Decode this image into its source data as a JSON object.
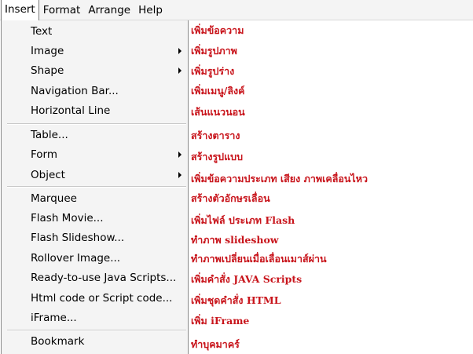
{
  "menubar": {
    "items": [
      {
        "label": "Insert",
        "active": true
      },
      {
        "label": "Format",
        "active": false
      },
      {
        "label": "Arrange",
        "active": false
      },
      {
        "label": "Help",
        "active": false
      }
    ]
  },
  "insert_menu": {
    "items": [
      {
        "label": "Text",
        "submenu": false
      },
      {
        "label": "Image",
        "submenu": true
      },
      {
        "label": "Shape",
        "submenu": true
      },
      {
        "label": "Navigation Bar...",
        "submenu": false
      },
      {
        "label": "Horizontal Line",
        "submenu": false
      },
      {
        "label": "Table...",
        "submenu": false
      },
      {
        "label": "Form",
        "submenu": true
      },
      {
        "label": "Object",
        "submenu": true
      },
      {
        "label": "Marquee",
        "submenu": false
      },
      {
        "label": "Flash Movie...",
        "submenu": false
      },
      {
        "label": "Flash Slideshow...",
        "submenu": false
      },
      {
        "label": "Rollover Image...",
        "submenu": false
      },
      {
        "label": "Ready-to-use Java Scripts...",
        "submenu": false
      },
      {
        "label": "Html code or Script code...",
        "submenu": false
      },
      {
        "label": "iFrame...",
        "submenu": false
      },
      {
        "label": "Bookmark",
        "submenu": false
      }
    ]
  },
  "annotations": [
    "เพิ่มข้อความ",
    "เพิ่มรูปภาพ",
    "เพิ่มรูปร่าง",
    "เพิ่มเมนู/ลิงค์",
    "เส้นแนวนอน",
    "สร้างตาราง",
    "สร้างรูปแบบ",
    "เพิ่มข้อความประเภท เสียง ภาพเคลื่อนไหว",
    "สร้างตัวอักษรเลื่อน",
    "เพิ่มไฟล์ ประเภท Flash",
    "ทำภาพ slideshow",
    "ทำภาพเปลี่ยนเมื่อเลื่อนเมาส์ผ่าน",
    "เพิ่มคำสั่ง JAVA Scripts",
    "เพิ่มชุดคำสั่ง HTML",
    "เพิ่ม iFrame",
    "ทำบุคมาคร์"
  ],
  "colors": {
    "menu_bg": "#f4f4f4",
    "annotation_red": "#c8141b"
  },
  "icons": {
    "submenu_arrow": "triangle-right-icon"
  }
}
